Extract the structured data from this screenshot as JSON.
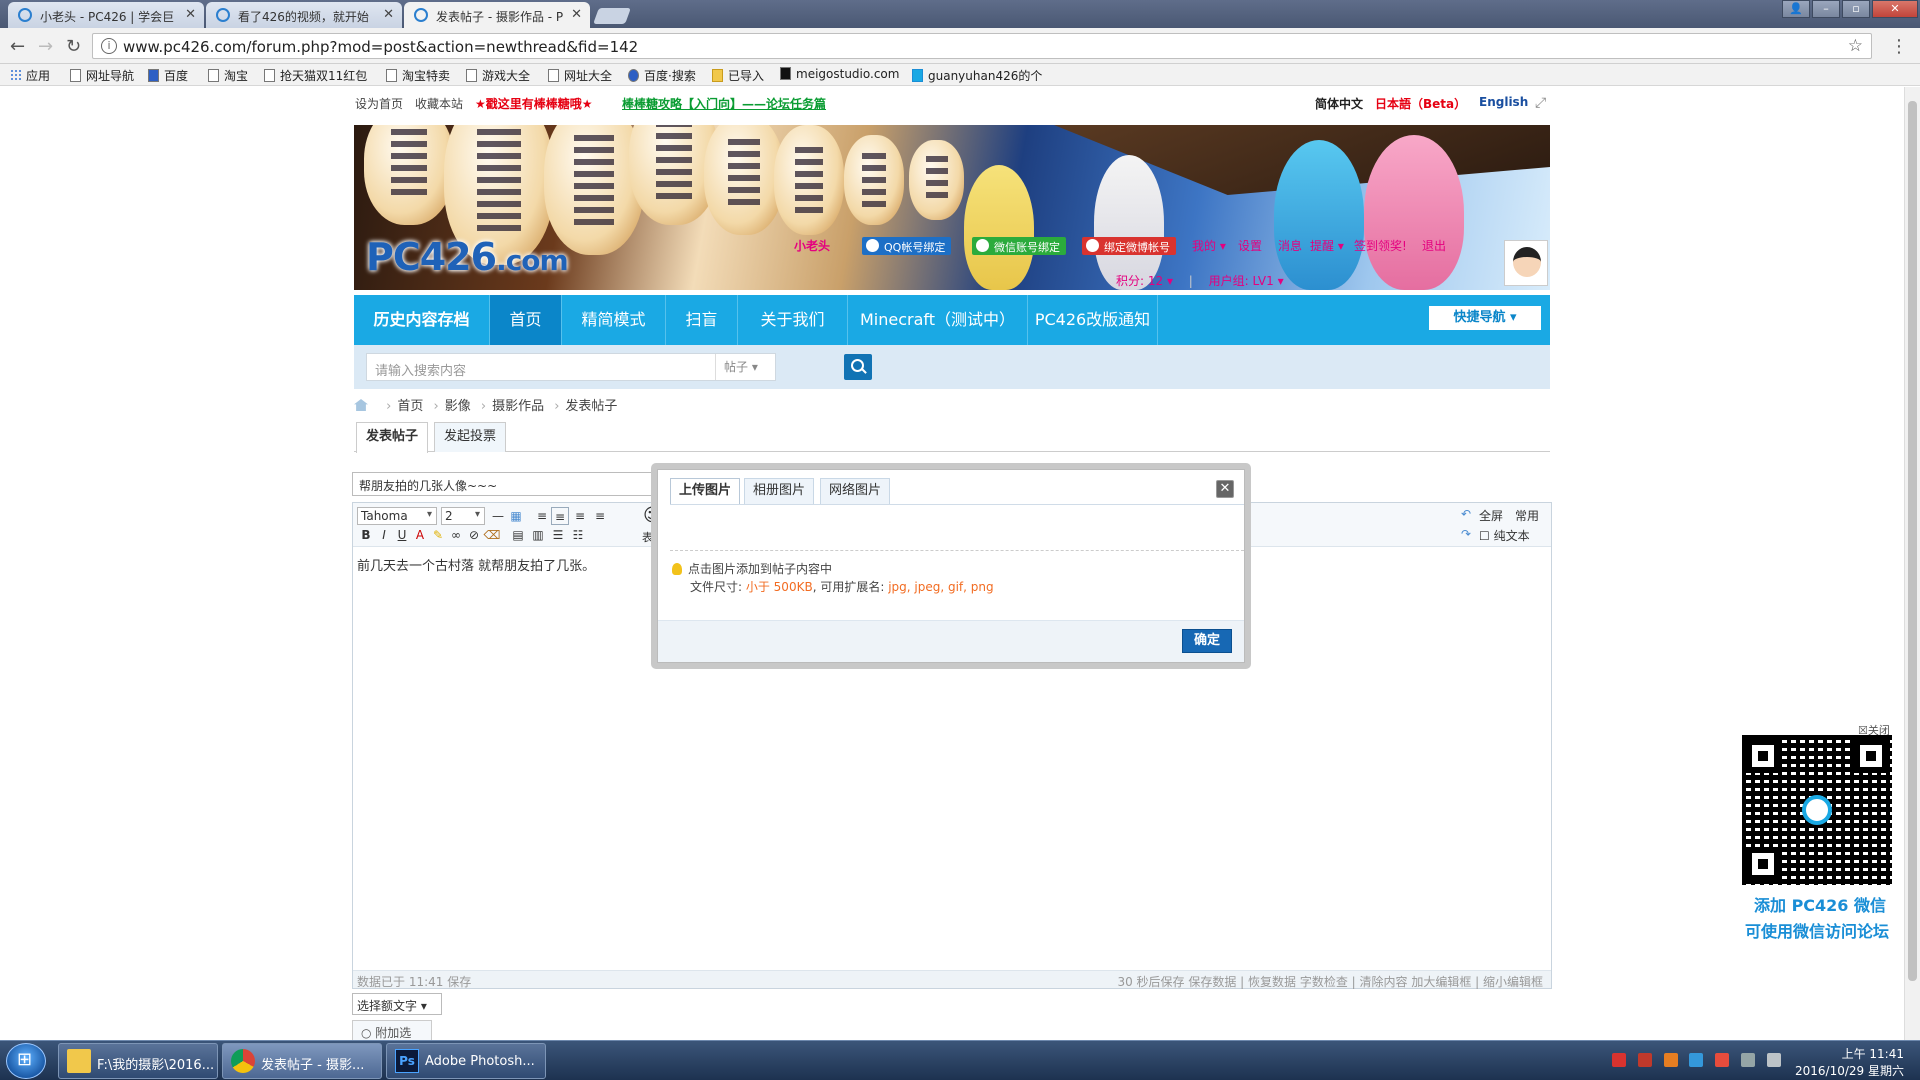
{
  "browser": {
    "tabs": [
      {
        "title": "小老头 - PC426 | 学会巨"
      },
      {
        "title": "看了426的视频，就开始"
      },
      {
        "title": "发表帖子 - 摄影作品 - P"
      }
    ],
    "url": "www.pc426.com/forum.php?mod=post&action=newthread&fid=142",
    "bookmarks": [
      "应用",
      "网址导航",
      "百度",
      "淘宝",
      "抢天猫双11红包",
      "淘宝特卖",
      "游戏大全",
      "网址大全",
      "百度·搜索",
      "已导入",
      "meigostudio.com",
      "guanyuhan426的个"
    ]
  },
  "topline": {
    "set_home": "设为首页",
    "bookmark": "收藏本站",
    "promo": "★戳这里有棒棒糖哦★",
    "guide": "棒棒糖攻略【入门向】——论坛任务篇",
    "lang_cn": "简体中文",
    "lang_jp": "日本語（Beta）",
    "lang_en": "English"
  },
  "header": {
    "logo_main": "PC426",
    "logo_suffix": ".com",
    "user": {
      "name": "小老头",
      "qq_bind": "QQ帐号绑定",
      "wechat_bind": "微信账号绑定",
      "weibo_bind": "绑定微博帐号",
      "mine": "我的",
      "settings": "设置",
      "messages": "消息",
      "reminders": "提醒",
      "checkin": "签到领奖!",
      "logout": "退出",
      "score": "积分: 12",
      "group": "用户组: LV1"
    }
  },
  "nav": {
    "items": [
      "历史内容存档",
      "首页",
      "精简模式",
      "扫盲",
      "关于我们",
      "Minecraft（测试中）",
      "PC426改版通知"
    ],
    "quick_nav": "快捷导航"
  },
  "search": {
    "placeholder": "请输入搜索内容",
    "type": "帖子"
  },
  "breadcrumb": [
    "首页",
    "影像",
    "摄影作品",
    "发表帖子"
  ],
  "post_tabs": [
    "发表帖子",
    "发起投票"
  ],
  "editor": {
    "subject": "帮朋友拍的几张人像~~~",
    "font": "Tahoma",
    "size": "2",
    "emoji_label": "表情",
    "fullscreen": "全屏",
    "common": "常用",
    "plain_text": "纯文本",
    "body": "前几天去一个古村落  就帮朋友拍了几张。",
    "saved": "数据已于 11:41 保存",
    "footer_links": "30 秒后保存 保存数据 | 恢复数据    字数检查 | 清除内容    加大编辑框 | 缩小编辑框",
    "extra_select": "选择额文字",
    "add_options": "附加选项"
  },
  "modal": {
    "tabs": [
      "上传图片",
      "相册图片",
      "网络图片"
    ],
    "tip": "点击图片添加到帖子内容中",
    "file_prefix": "文件尺寸: ",
    "file_size": "小于 500KB",
    "file_mid": ", 可用扩展名: ",
    "file_exts": "jpg, jpeg, gif, png",
    "confirm": "确定"
  },
  "qr": {
    "close": "关闭",
    "line1": "添加 PC426 微信",
    "line2": "可使用微信访问论坛"
  },
  "taskbar": {
    "items": [
      "F:\\我的摄影\\2016...",
      "发表帖子 - 摄影...",
      "Adobe Photosh..."
    ],
    "time": "上午 11:41",
    "date": "2016/10/29 星期六"
  }
}
